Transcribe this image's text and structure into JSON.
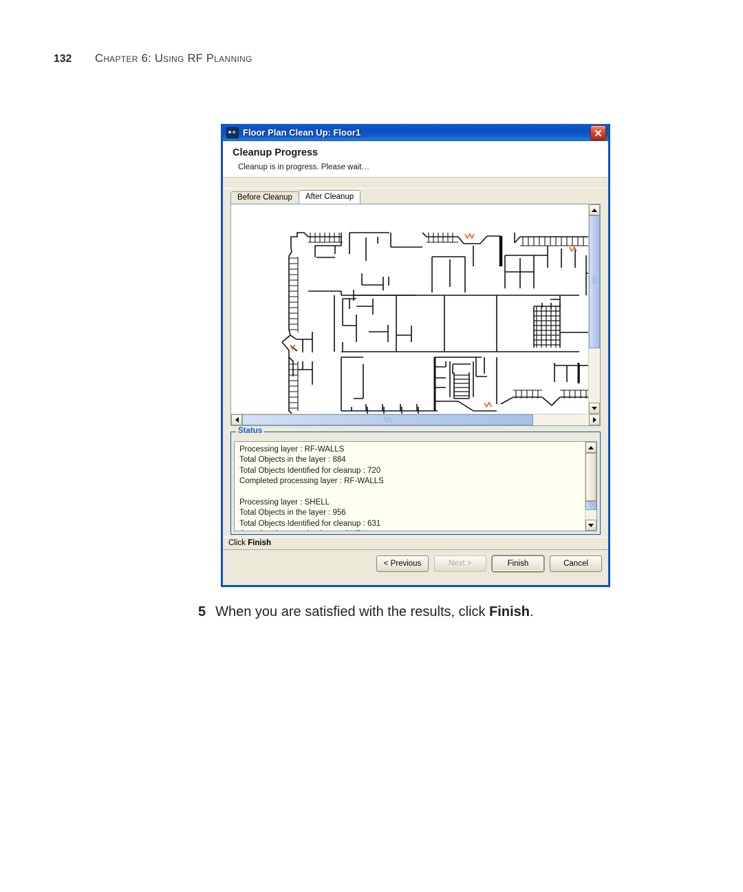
{
  "page": {
    "number": "132",
    "chapter_title": "Chapter 6: Using RF Planning"
  },
  "step": {
    "number": "5",
    "text_before": "When you are satisfied with the results, click ",
    "bold_word": "Finish",
    "text_after": "."
  },
  "dialog": {
    "title": "Floor Plan Clean Up: Floor1",
    "title_icon": "floorplan-icon",
    "close_icon": "close-icon",
    "heading": "Cleanup Progress",
    "subtext": "Cleanup is in progress. Please wait…",
    "tabs": [
      {
        "label": "Before Cleanup",
        "active": false
      },
      {
        "label": "After Cleanup",
        "active": true
      }
    ],
    "status": {
      "legend": "Status",
      "lines": "Processing layer : RF-WALLS\nTotal Objects in the layer : 884\nTotal Objects Identified for cleanup : 720\nCompleted processing layer : RF-WALLS\n\nProcessing layer : SHELL\nTotal Objects in the layer : 956\nTotal Objects Identified for cleanup : 631\nCompleted processing layer : SHELL"
    },
    "prompt": {
      "text_before": "Click ",
      "bold_word": "Finish",
      "text_after": ""
    },
    "buttons": [
      {
        "label": "< Previous",
        "state": "enabled"
      },
      {
        "label": "Next >",
        "state": "disabled"
      },
      {
        "label": "Finish",
        "state": "default"
      },
      {
        "label": "Cancel",
        "state": "enabled"
      }
    ],
    "colors": {
      "titlebar": "#0a52c8",
      "dialog_face": "#ece9d8",
      "status_field": "#fffff0",
      "legend_text": "#1c5fc4",
      "close_button": "#c6331c",
      "scrollbar_thumb": "#b8cbec",
      "door_marker": "#e8622a"
    }
  }
}
